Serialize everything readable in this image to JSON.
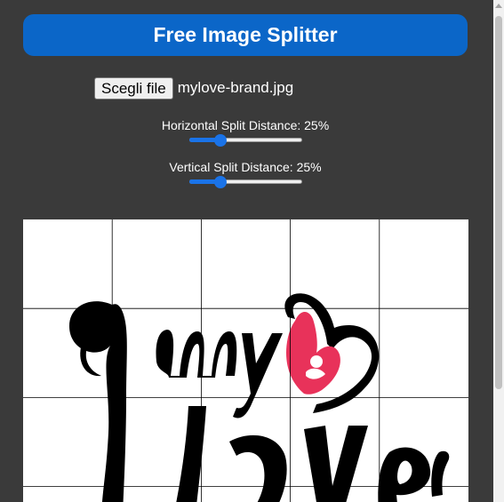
{
  "header": {
    "title": "Free Image Splitter"
  },
  "file_input": {
    "button_label": "Scegli file",
    "file_name": "mylove-brand.jpg"
  },
  "controls": {
    "horizontal": {
      "label": "Horizontal Split Distance: 25%",
      "value_percent": 25
    },
    "vertical": {
      "label": "Vertical Split Distance: 25%",
      "value_percent": 25
    }
  },
  "preview": {
    "grid_color": "#000000",
    "logo_text_color": "#000000",
    "heart_accent_color": "#e8325a"
  },
  "colors": {
    "background": "#3a3a3a",
    "header": "#0b66c8",
    "slider_accent": "#1a73e8"
  }
}
